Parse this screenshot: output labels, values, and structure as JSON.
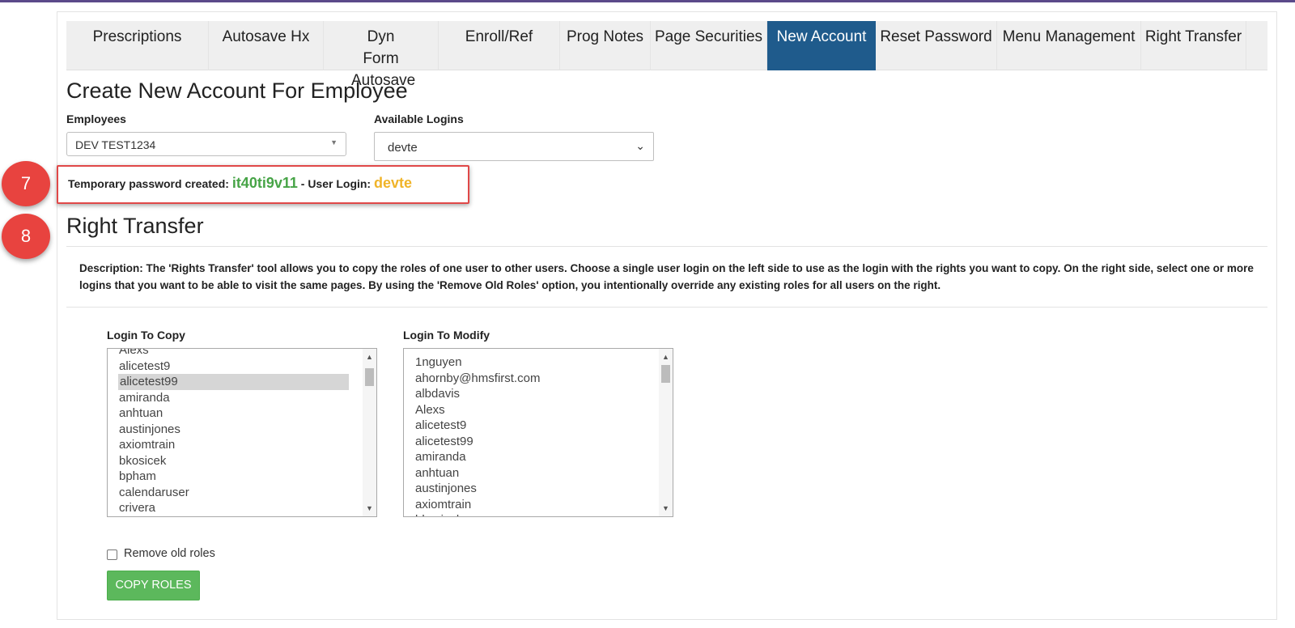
{
  "tabs": [
    {
      "label": "Prescriptions"
    },
    {
      "label": "Autosave Hx"
    },
    {
      "label": "Dyn Form Autosave"
    },
    {
      "label": "Enroll/Ref"
    },
    {
      "label": "Prog Notes"
    },
    {
      "label": "Page Securities"
    },
    {
      "label": "New Account"
    },
    {
      "label": "Reset Password"
    },
    {
      "label": "Menu Management"
    },
    {
      "label": "Right Transfer"
    }
  ],
  "new_account": {
    "title": "Create New Account For Employee",
    "employees_label": "Employees",
    "employees_value": "DEV TEST1234",
    "logins_label": "Available Logins",
    "logins_value": "devte"
  },
  "temp_message": {
    "prefix": "Temporary password created: ",
    "password": "it40ti9v11",
    "middle": " - User Login: ",
    "login": "devte"
  },
  "badges": {
    "first": "7",
    "second": "8"
  },
  "right_transfer": {
    "title": "Right Transfer",
    "description": "Description: The 'Rights Transfer' tool allows you to copy the roles of one user to other users. Choose a single user login on the left side to use as the login with the rights you want to copy. On the right side, select one or more logins that you want to be able to visit the same pages. By using the 'Remove Old Roles' option, you intentionally override any existing roles for all users on the right.",
    "login_to_copy_label": "Login To Copy",
    "login_to_modify_label": "Login To Modify",
    "login_to_copy_items": [
      "Alexs",
      "alicetest9",
      "alicetest99",
      "amiranda",
      "anhtuan",
      "austinjones",
      "axiomtrain",
      "bkosicek",
      "bpham",
      "calendaruser",
      "crivera"
    ],
    "login_to_copy_selected": "alicetest99",
    "login_to_modify_items": [
      "1nguyen",
      "ahornby@hmsfirst.com",
      "albdavis",
      "Alexs",
      "alicetest9",
      "alicetest99",
      "amiranda",
      "anhtuan",
      "austinjones",
      "axiomtrain",
      "bkosicek"
    ],
    "remove_old_roles_label": "Remove old roles",
    "remove_old_roles_checked": false,
    "copy_button": "COPY ROLES"
  },
  "colors": {
    "active_tab": "#1f5b8c",
    "password": "#47a447",
    "login": "#f0b429",
    "badge": "#e8433f",
    "button": "#5cb85c"
  }
}
